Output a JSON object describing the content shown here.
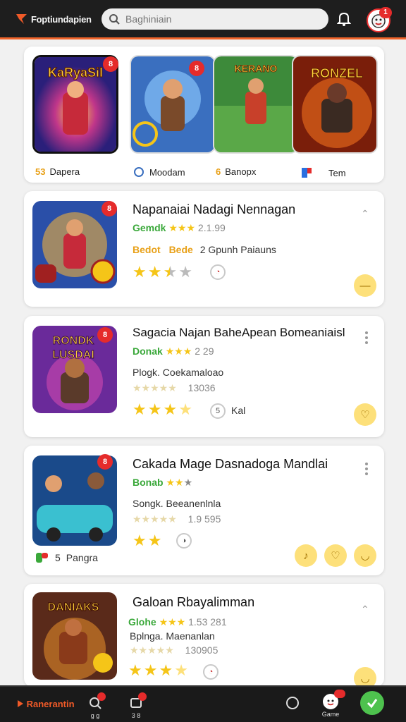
{
  "header": {
    "logo_text": "Foptiundapien",
    "search_placeholder": "Baghiniain",
    "notif_badge": "1"
  },
  "featured": [
    {
      "title_art": "KaRyaSil",
      "label": "Dapera",
      "label_prefix": "53",
      "badge": "8"
    },
    {
      "title_art": "",
      "label": "Moodam",
      "label_prefix": "",
      "badge": "8"
    },
    {
      "title_art": "KERANO",
      "label": "Banopx",
      "label_prefix": "6",
      "badge": ""
    },
    {
      "title_art": "RONZEL",
      "label": "Tem",
      "label_prefix": "",
      "badge": ""
    }
  ],
  "cards": [
    {
      "title": "Napanaiai Nadagi Nennagan",
      "line1_green": "Gemdk",
      "line1_rest": "2.1.99",
      "line2_orange": "Bedot",
      "line2_orange2": "Bede",
      "line2_rest": "2  Gpunh Paiauns",
      "rating": 2.5,
      "badge": "8",
      "thumb_art": ""
    },
    {
      "title": "Sagacia Najan BaheApean Bomeaniaisl",
      "line1_green": "Donak",
      "line1_rest": "2  29",
      "line2": "Plogk. Coekamaloao",
      "line3": "13036",
      "rating": 3.5,
      "badge": "8",
      "thumb_art": "RONDK LUSDAI",
      "ring_label": "Kal"
    },
    {
      "title": "Cakada Mage Dasnadoga Mandlai",
      "line1_green": "Bonab",
      "line2": "Songk. Beeanenlnla",
      "line3": "1.9 595",
      "rating": 2,
      "badge": "8",
      "thumb_art": "",
      "footer_label": "Pangra",
      "footer_prefix": "5"
    },
    {
      "title": "Galoan Rbayalimman",
      "line1_green": "Glohe",
      "line1_rest": "1.53 281",
      "line2": "Bplnga. Maenanlan",
      "line3": "130905",
      "rating": 3.5,
      "thumb_art": "DANIAKS"
    }
  ],
  "bottom_nav": {
    "brand": "Ranerantin",
    "item1": "g g",
    "item2": "3  8",
    "item4": "Game"
  },
  "colors": {
    "accent": "#f0642a",
    "green": "#4ec24e",
    "star": "#f5c518",
    "red_badge": "#e52b2b"
  }
}
